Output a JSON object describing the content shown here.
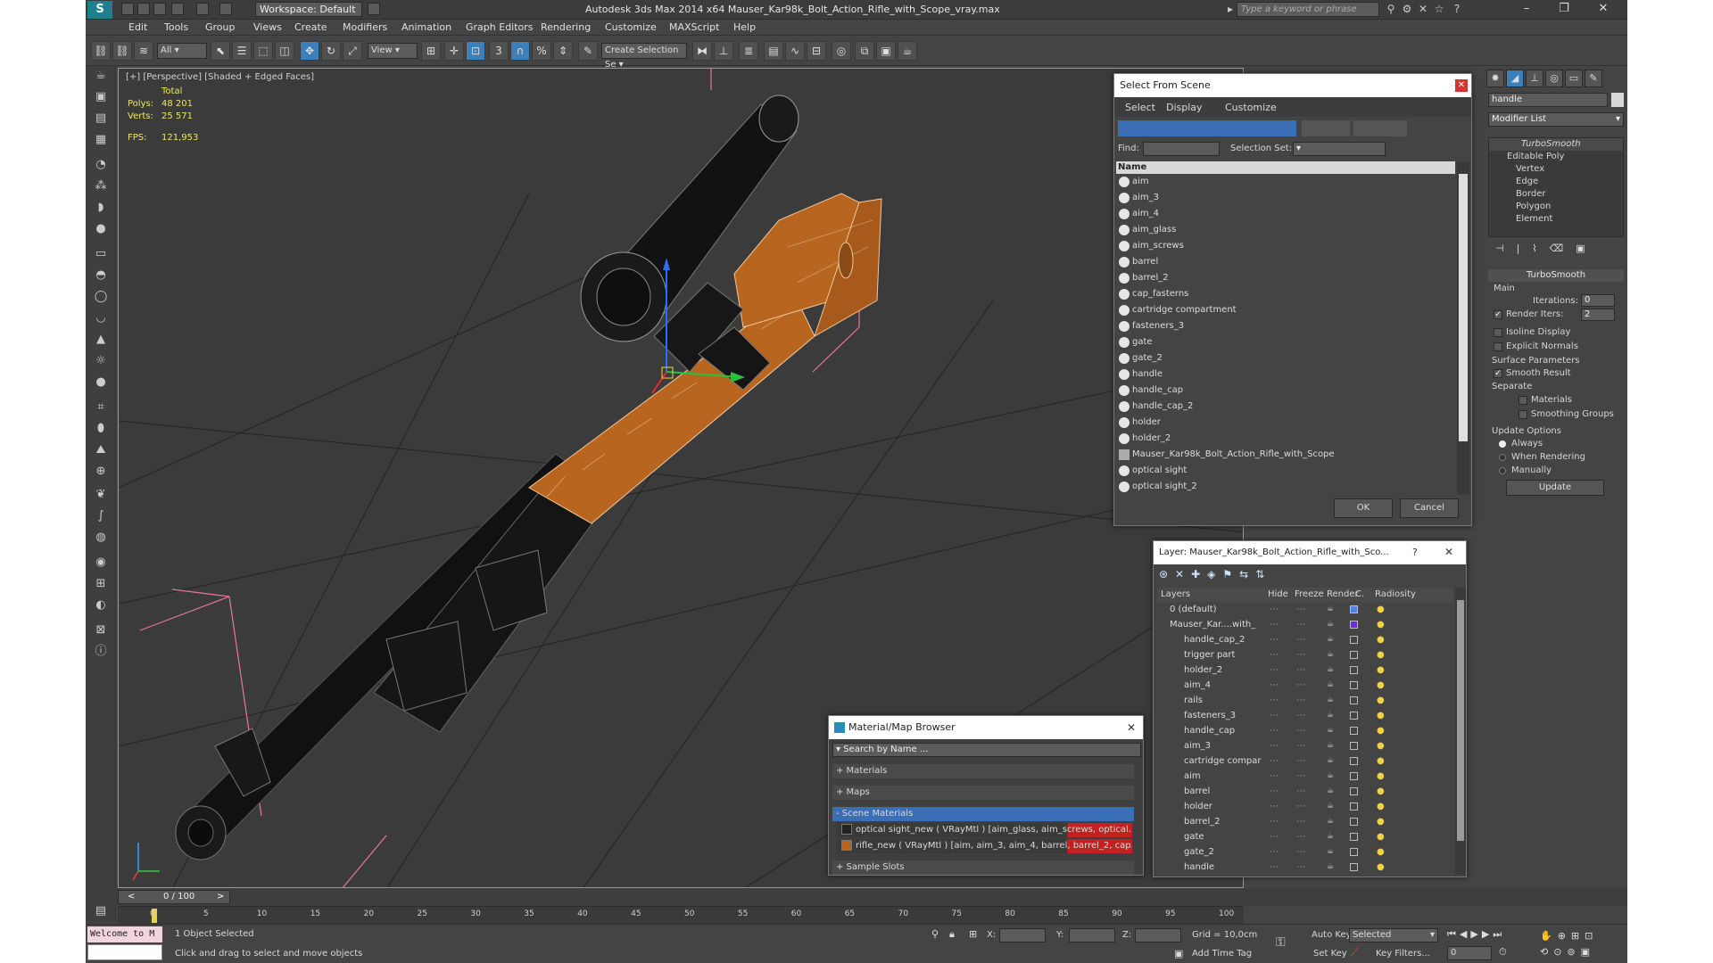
{
  "title_bar": {
    "workspace": "Workspace: Default",
    "title": "Autodesk 3ds Max  2014 x64     Mauser_Kar98k_Bolt_Action_Rifle_with_Scope_vray.max",
    "search_placeholder": "Type a keyword or phrase"
  },
  "menu": [
    "Edit",
    "Tools",
    "Group",
    "Views",
    "Create",
    "Modifiers",
    "Animation",
    "Graph Editors",
    "Rendering",
    "Customize",
    "MAXScript",
    "Help"
  ],
  "toolbar": {
    "filter": "All",
    "ref_coord": "View",
    "selection_set": "Create Selection Se"
  },
  "viewport": {
    "label": "[+] [Perspective] [Shaded + Edged Faces]",
    "stats_header": "Total",
    "polys_label": "Polys:",
    "polys_value": "48 201",
    "verts_label": "Verts:",
    "verts_value": "25 571",
    "fps_label": "FPS:",
    "fps_value": "121,953"
  },
  "select_from_scene": {
    "title": "Select From Scene",
    "menus": [
      "Select",
      "Display",
      "Customize"
    ],
    "find_label": "Find:",
    "selection_set_label": "Selection Set:",
    "column": "Name",
    "items": [
      "aim",
      "aim_3",
      "aim_4",
      "aim_glass",
      "aim_screws",
      "barrel",
      "barrel_2",
      "cap_fasterns",
      "cartridge compartment",
      "fasteners_3",
      "gate",
      "gate_2",
      "handle",
      "handle_cap",
      "handle_cap_2",
      "holder",
      "holder_2",
      "Mauser_Kar98k_Bolt_Action_Rifle_with_Scope",
      "optical sight",
      "optical sight_2"
    ],
    "ok": "OK",
    "cancel": "Cancel"
  },
  "layer_manager": {
    "title": "Layer: Mauser_Kar98k_Bolt_Action_Rifle_with_Sco...",
    "help": "?",
    "columns": [
      "Layers",
      "Hide",
      "Freeze",
      "Render",
      "C.",
      "Radiosity"
    ],
    "rows": [
      "0 (default)",
      "Mauser_Kar....with_",
      "handle_cap_2",
      "trigger part",
      "holder_2",
      "aim_4",
      "rails",
      "fasteners_3",
      "handle_cap",
      "aim_3",
      "cartridge compar",
      "aim",
      "barrel",
      "holder",
      "barrel_2",
      "gate",
      "gate_2",
      "handle"
    ]
  },
  "material_browser": {
    "title": "Material/Map Browser",
    "search_placeholder": "Search by Name ...",
    "groups": [
      "+ Materials",
      "+ Maps",
      "- Scene Materials",
      "+ Sample Slots"
    ],
    "scene_materials": [
      "optical sight_new  ( VRayMtl ) [aim_glass, aim_screws, optical...",
      "rifle_new  ( VRayMtl )  [aim, aim_3, aim_4, barrel, barrel_2, cap..."
    ]
  },
  "command_panel": {
    "name": "handle",
    "modifier_list": "Modifier List",
    "stack": [
      "TurboSmooth",
      "Editable Poly",
      "Vertex",
      "Edge",
      "Border",
      "Polygon",
      "Element"
    ],
    "rollout_title": "TurboSmooth",
    "main_label": "Main",
    "iterations_label": "Iterations:",
    "iterations_value": "0",
    "render_iters_label": "Render Iters:",
    "render_iters_value": "2",
    "isoline": "Isoline Display",
    "explicit_normals": "Explicit Normals",
    "surface_params": "Surface Parameters",
    "smooth_result": "Smooth Result",
    "separate": "Separate",
    "materials": "Materials",
    "smoothing_groups": "Smoothing Groups",
    "update_options": "Update Options",
    "always": "Always",
    "when_rendering": "When Rendering",
    "manually": "Manually",
    "update": "Update"
  },
  "timeline": {
    "frame": "0 / 100",
    "ticks": [
      "0",
      "5",
      "10",
      "15",
      "20",
      "25",
      "30",
      "35",
      "40",
      "45",
      "50",
      "55",
      "60",
      "65",
      "70",
      "75",
      "80",
      "85",
      "90",
      "95",
      "100"
    ]
  },
  "status": {
    "maxscript": "Welcome to M",
    "selected": "1 Object Selected",
    "prompt": "Click and drag to select and move objects",
    "x_label": "X:",
    "y_label": "Y:",
    "z_label": "Z:",
    "grid": "Grid = 10,0cm",
    "add_time_tag": "Add Time Tag",
    "auto_key": "Auto Key",
    "selected_combo": "Selected",
    "set_key": "Set Key",
    "key_filters": "Key Filters...",
    "frame_value": "0"
  },
  "colors": {
    "wood": "#b8651f",
    "viewport_bg": "#3b3b3b",
    "accent_blue": "#3d7fb8",
    "selection_highlight": "#3b6fb5"
  }
}
